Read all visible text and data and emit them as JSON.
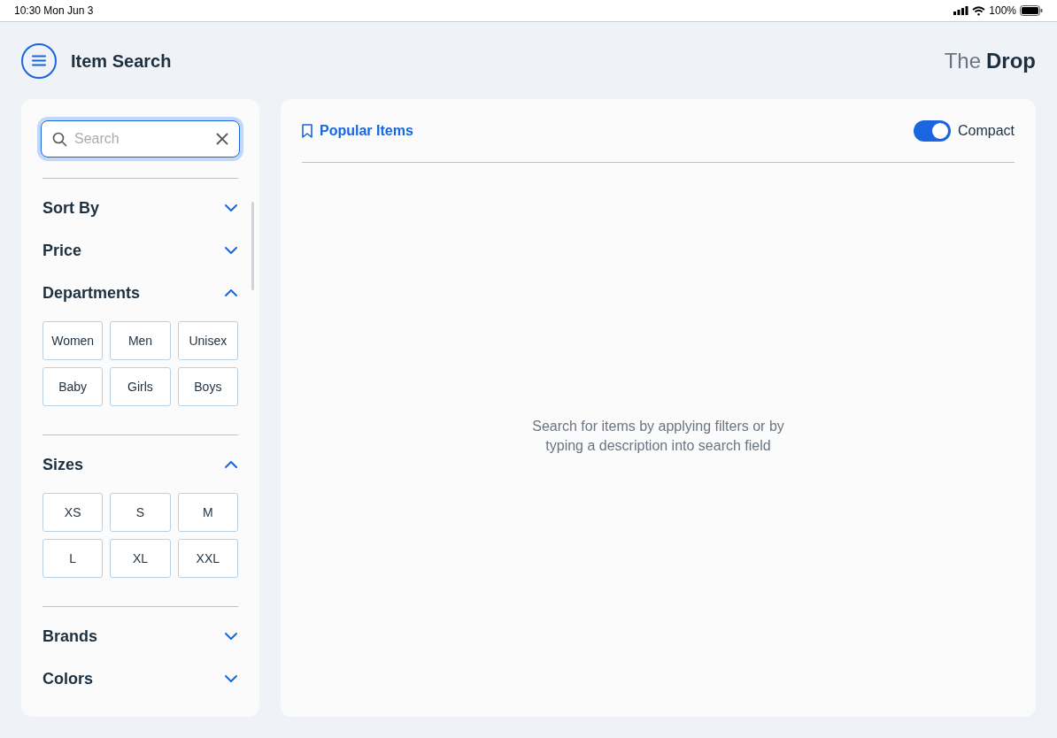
{
  "status_bar": {
    "time": "10:30 Mon Jun 3",
    "battery": "100%"
  },
  "header": {
    "title": "Item Search",
    "brand_light": "The",
    "brand_bold": "Drop"
  },
  "search": {
    "placeholder": "Search"
  },
  "filters": [
    {
      "title": "Sort By",
      "expanded": false
    },
    {
      "title": "Price",
      "expanded": false
    },
    {
      "title": "Departments",
      "expanded": true,
      "options": [
        "Women",
        "Men",
        "Unisex",
        "Baby",
        "Girls",
        "Boys"
      ]
    },
    {
      "title": "Sizes",
      "expanded": true,
      "options": [
        "XS",
        "S",
        "M",
        "L",
        "XL",
        "XXL"
      ]
    },
    {
      "title": "Brands",
      "expanded": false
    },
    {
      "title": "Colors",
      "expanded": false
    }
  ],
  "main": {
    "tab": "Popular Items",
    "toggle": {
      "label": "Compact",
      "on": true
    },
    "empty_message": "Search for items by applying filters or by typing a description into search field"
  }
}
